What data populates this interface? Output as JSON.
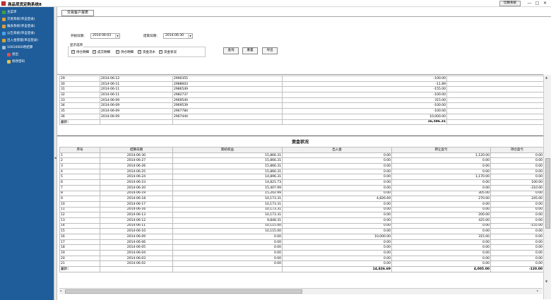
{
  "window": {
    "title": "商品现货定购系统8",
    "switch_label": "切换系统",
    "min_glyph": "—",
    "max_glyph": "□",
    "close_glyph": "✕"
  },
  "sidebar": {
    "items": [
      {
        "label": "主菜单",
        "icon": "home-icon",
        "color": "#3da13d"
      },
      {
        "label": "交易系统(单击登录)",
        "icon": "trade-icon",
        "color": "#d9a23a"
      },
      {
        "label": "报表系统(单击登录)",
        "icon": "report-icon",
        "color": "#d9a23a"
      },
      {
        "label": "公告系统(单击登录)",
        "icon": "notice-icon",
        "color": "#4aa3df"
      },
      {
        "label": "出入金管理(单击登录)",
        "icon": "money-icon",
        "color": "#d9a23a"
      },
      {
        "label": "10010000吧结算",
        "icon": "settle-icon",
        "color": "#9bbbd9"
      },
      {
        "label": "退出",
        "icon": "exit-icon",
        "color": "#e05050"
      },
      {
        "label": "修改密码",
        "icon": "key-icon",
        "color": "#e0c050"
      }
    ]
  },
  "tab": {
    "label": "交易客户报表"
  },
  "filters": {
    "start_label": "开始日期：",
    "start_value": "2014-06-03",
    "end_label": "结束日期：",
    "end_value": "2014-06-30",
    "group_title": "显示选项",
    "checkboxes": [
      "持仓明细",
      "成交明细",
      "持仓明细",
      "资金流水",
      "资金状况"
    ],
    "buttons": {
      "query": "查询",
      "reset": "重置",
      "export": "导出"
    }
  },
  "upper_table": {
    "rows": [
      [
        "29",
        "2014-06-12",
        "2990355",
        "-100.00"
      ],
      [
        "30",
        "2014-06-11",
        "2988603",
        "-11.89"
      ],
      [
        "31",
        "2014-06-11",
        "2986549",
        "-155.00"
      ],
      [
        "32",
        "2014-06-11",
        "2982737",
        "-100.00"
      ],
      [
        "33",
        "2014-06-09",
        "2969540",
        "315.00"
      ],
      [
        "34",
        "2014-06-09",
        "2969539",
        "-100.00"
      ],
      [
        "35",
        "2014-06-09",
        "2967784",
        "-100.00"
      ],
      [
        "36",
        "2014-06-09",
        "2967444",
        "10,000.00"
      ]
    ],
    "total_label": "总计：",
    "total_value": "16,586.31"
  },
  "lower_table": {
    "title": "资金状况",
    "headers": [
      "序号",
      "结算日期",
      "期初权益",
      "出入金",
      "转让盈亏",
      "持仓盈亏"
    ],
    "rows": [
      [
        "1",
        "2014-06-30",
        "15,866.31",
        "0.00",
        "1,120.00",
        "0.00"
      ],
      [
        "2",
        "2014-06-27",
        "15,866.31",
        "0.00",
        "0.00",
        "0.00"
      ],
      [
        "3",
        "2014-06-26",
        "15,866.31",
        "0.00",
        "0.00",
        "0.00"
      ],
      [
        "4",
        "2014-06-25",
        "15,866.31",
        "0.00",
        "0.00",
        "0.00"
      ],
      [
        "5",
        "2014-06-24",
        "14,896.31",
        "0.00",
        "1,170.00",
        "0.00"
      ],
      [
        "6",
        "2014-06-23",
        "14,821.73",
        "0.00",
        "0.00",
        "100.00"
      ],
      [
        "7",
        "2014-06-20",
        "15,407.99",
        "0.00",
        "0.00",
        "-310.00"
      ],
      [
        "8",
        "2014-06-19",
        "15,202.99",
        "0.00",
        "305.00",
        "0.00"
      ],
      [
        "9",
        "2014-06-18",
        "10,173.31",
        "4,826.69",
        "270.00",
        "245.00"
      ],
      [
        "10",
        "2014-06-17",
        "10,173.31",
        "0.00",
        "0.00",
        "0.00"
      ],
      [
        "11",
        "2014-06-16",
        "10,173.31",
        "0.00",
        "0.00",
        "0.00"
      ],
      [
        "12",
        "2014-06-13",
        "10,173.31",
        "0.00",
        "200.00",
        "0.00"
      ],
      [
        "13",
        "2014-06-12",
        "9,848.31",
        "0.00",
        "425.00",
        "0.00"
      ],
      [
        "14",
        "2014-06-11",
        "10,115.00",
        "0.00",
        "0.00",
        "-155.00"
      ],
      [
        "15",
        "2014-06-10",
        "10,115.00",
        "0.00",
        "0.00",
        "0.00"
      ],
      [
        "16",
        "2014-06-09",
        "0.00",
        "10,000.00",
        "315.00",
        "0.00"
      ],
      [
        "17",
        "2014-06-06",
        "0.00",
        "0.00",
        "0.00",
        "0.00"
      ],
      [
        "18",
        "2014-06-05",
        "0.00",
        "0.00",
        "0.00",
        "0.00"
      ],
      [
        "19",
        "2014-06-04",
        "0.00",
        "0.00",
        "0.00",
        "0.00"
      ],
      [
        "20",
        "2014-06-03",
        "0.00",
        "0.00",
        "0.00",
        "0.00"
      ],
      [
        "21",
        "2014-06-02",
        "0.00",
        "0.00",
        "0.00",
        "0.00"
      ]
    ],
    "total_label": "总计：",
    "totals": [
      "14,826.69",
      "4,005.00",
      "-120.00"
    ]
  }
}
